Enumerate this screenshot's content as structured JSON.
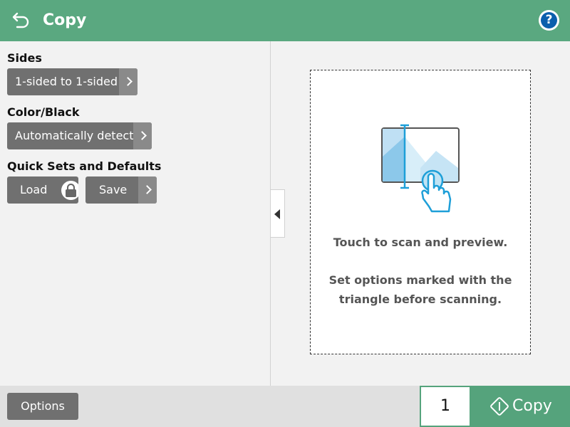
{
  "header": {
    "title": "Copy",
    "back_icon": "back-arrow-icon",
    "help_icon": "help-icon",
    "help_glyph": "?",
    "color": "#5aa880"
  },
  "settings": {
    "sides": {
      "label": "Sides",
      "value": "1-sided to 1-sided"
    },
    "color_black": {
      "label": "Color/Black",
      "value": "Automatically detect"
    },
    "quick_sets": {
      "label": "Quick Sets and Defaults",
      "load_label": "Load",
      "save_label": "Save"
    }
  },
  "preview": {
    "line1": "Touch to scan and preview.",
    "line2a": "Set options marked with the",
    "line2b": "triangle before scanning."
  },
  "footer": {
    "options_label": "Options",
    "copies": "1",
    "copy_label": "Copy",
    "accent": "#55a37c"
  }
}
